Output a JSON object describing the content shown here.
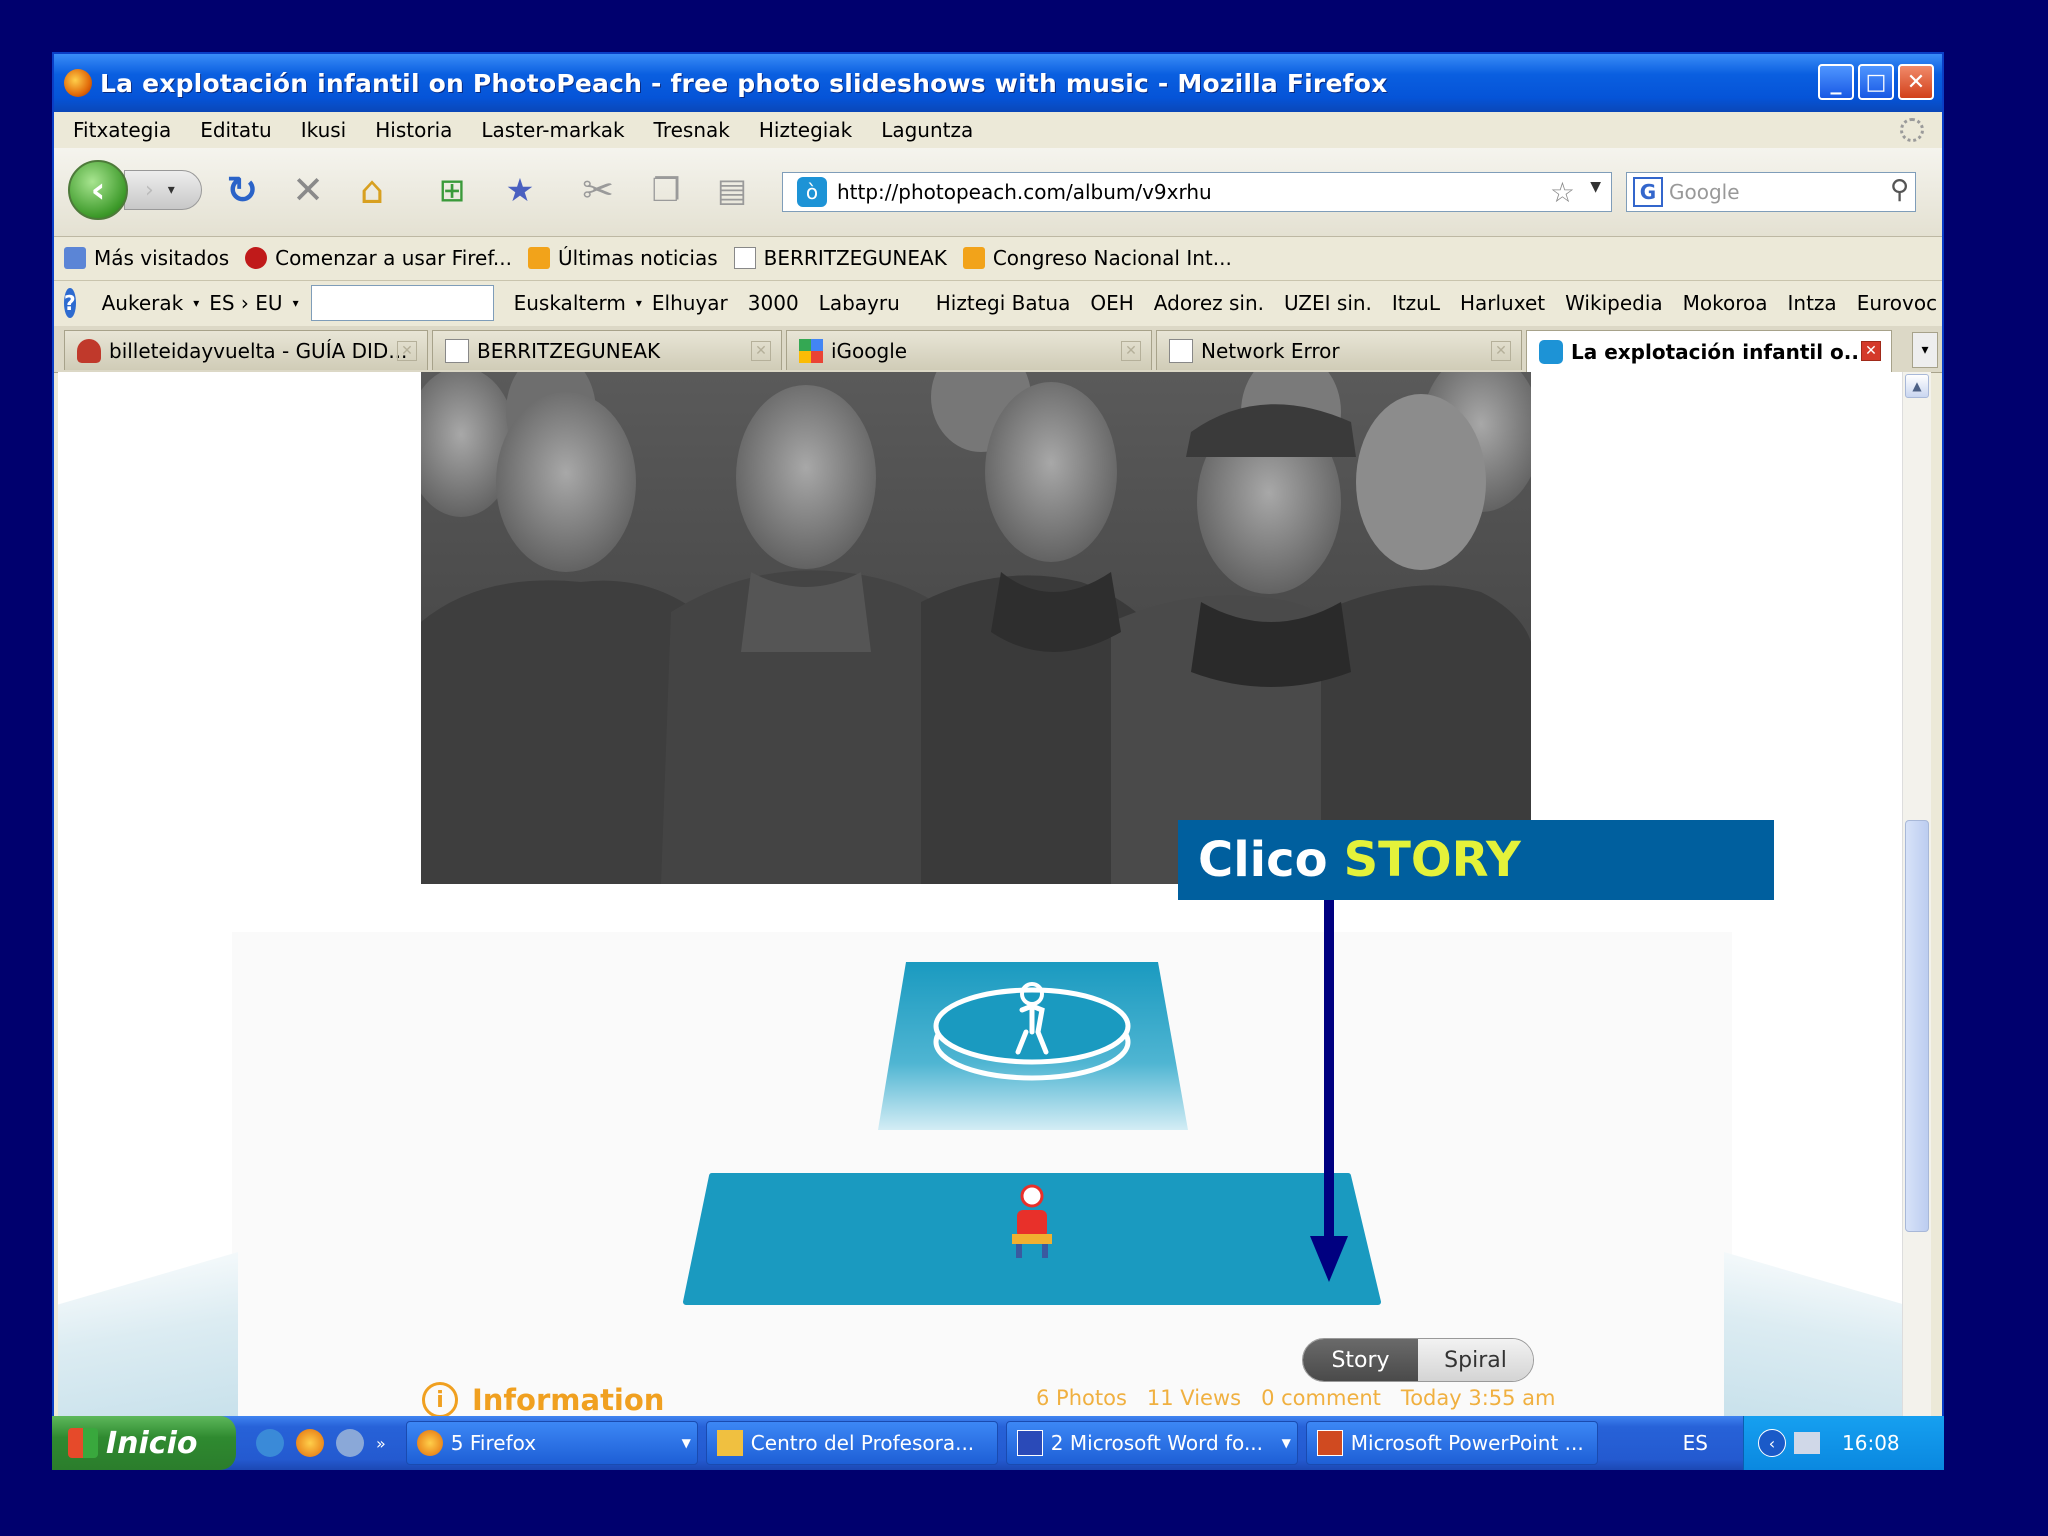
{
  "window": {
    "title": "La explotación infantil on PhotoPeach - free photo slideshows with music - Mozilla Firefox"
  },
  "menu": [
    "Fitxategia",
    "Editatu",
    "Ikusi",
    "Historia",
    "Laster-markak",
    "Tresnak",
    "Hiztegiak",
    "Laguntza"
  ],
  "toolbar": {
    "url": "http://photopeach.com/album/v9xrhu",
    "search_placeholder": "Google"
  },
  "bookmarks": [
    {
      "label": "Más visitados",
      "icon": "folder-icon"
    },
    {
      "label": "Comenzar a usar Firef...",
      "icon": "firefox-red-icon"
    },
    {
      "label": "Últimas noticias",
      "icon": "rss-icon"
    },
    {
      "label": "BERRITZEGUNEAK",
      "icon": "page-icon"
    },
    {
      "label": "Congreso Nacional Int...",
      "icon": "rss-icon"
    }
  ],
  "translator_bar": {
    "aukerak": "Aukerak",
    "lang": "ES › EU",
    "items": [
      "Euskalterm",
      "Elhuyar",
      "3000",
      "Labayru",
      "Hiztegi Batua",
      "OEH",
      "Adorez sin.",
      "UZEI sin.",
      "ItzuL",
      "Harluxet",
      "Wikipedia",
      "Mokoroa",
      "Intza",
      "Eurovoc"
    ]
  },
  "tabs": [
    {
      "label": "billeteidayvuelta - GUÍA DID...",
      "active": false
    },
    {
      "label": "BERRITZEGUNEAK",
      "active": false
    },
    {
      "label": "iGoogle",
      "active": false
    },
    {
      "label": "Network Error",
      "active": false
    },
    {
      "label": "La explotación infantil o...",
      "active": true
    }
  ],
  "page": {
    "story_label": "Story",
    "spiral_label": "Spiral",
    "meta": "6 Photos   11 Views   0 comment   Today 3:55 am",
    "info_label": "Information"
  },
  "callout": {
    "white": "Clico",
    "yellow": "STORY"
  },
  "taskbar": {
    "start": "Inicio",
    "buttons": [
      "5 Firefox",
      "Centro del Profesora...",
      "2 Microsoft Word fo...",
      "Microsoft PowerPoint ..."
    ],
    "lang": "ES",
    "time": "16:08"
  },
  "colors": {
    "callout_bg": "#005f9e",
    "callout_yellow": "#e4f23a",
    "accent": "#1a9ac0",
    "info": "#f0a020"
  }
}
